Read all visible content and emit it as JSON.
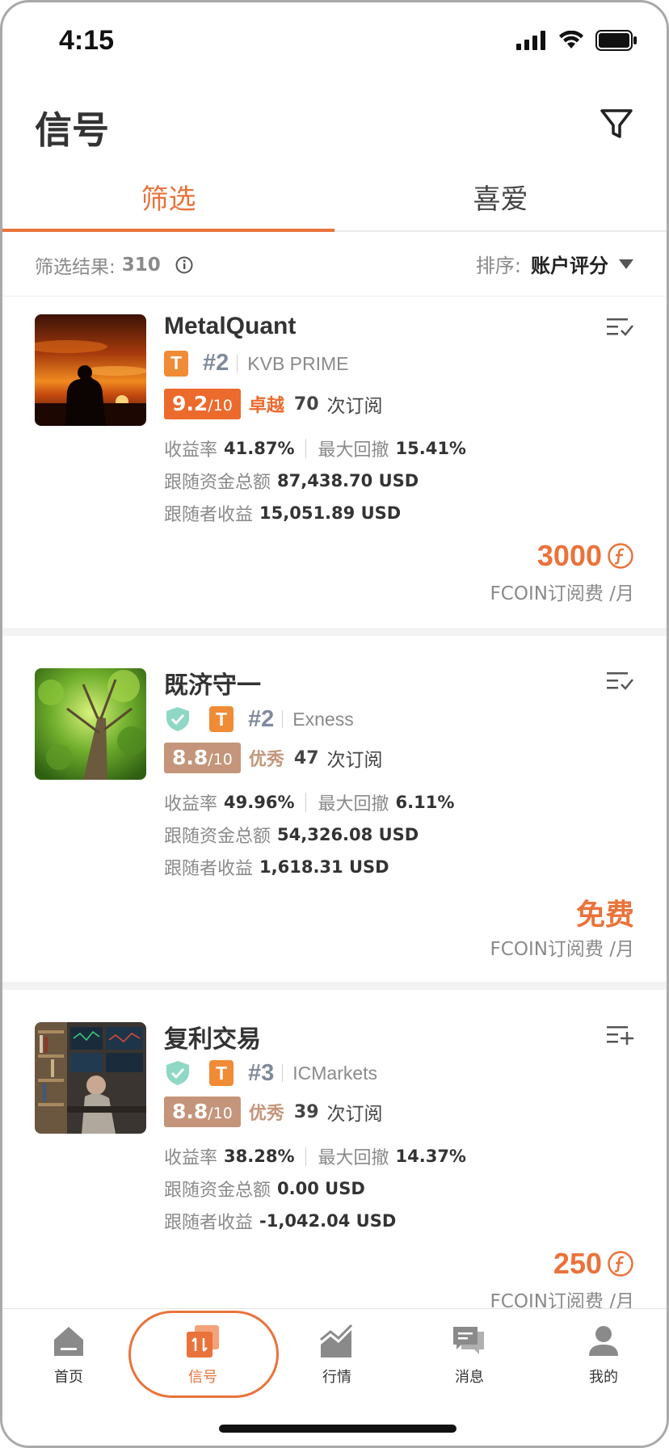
{
  "status_bar": {
    "time": "4:15"
  },
  "header": {
    "title": "信号"
  },
  "tabs": [
    {
      "label": "筛选",
      "active": true
    },
    {
      "label": "喜爱",
      "active": false
    }
  ],
  "result_bar": {
    "label": "筛选结果:",
    "count": "310",
    "sort_label": "排序:",
    "sort_value": "账户评分"
  },
  "colors": {
    "accent": "#e9733b",
    "score_excellent": "#ec6a2c",
    "score_good": "#c4957a",
    "shield": "#8fd8c6"
  },
  "signals": [
    {
      "name": "MetalQuant",
      "verified": false,
      "rank": "#2",
      "broker": "KVB PRIME",
      "score": "9.2",
      "score_den": "/10",
      "level": "卓越",
      "subs": "70",
      "subs_label": "次订阅",
      "return_label": "收益率",
      "return_value": "41.87%",
      "drawdown_label": "最大回撤",
      "drawdown_value": "15.41%",
      "funds_label": "跟随资金总额",
      "funds_value": "87,438.70 USD",
      "profit_label": "跟随者收益",
      "profit_value": "15,051.89 USD",
      "price": "3000",
      "price_label": "FCOIN订阅费 /月",
      "list_icon": "list-check-icon"
    },
    {
      "name": "既济守一",
      "verified": true,
      "rank": "#2",
      "broker": "Exness",
      "score": "8.8",
      "score_den": "/10",
      "level": "优秀",
      "subs": "47",
      "subs_label": "次订阅",
      "return_label": "收益率",
      "return_value": "49.96%",
      "drawdown_label": "最大回撤",
      "drawdown_value": "6.11%",
      "funds_label": "跟随资金总额",
      "funds_value": "54,326.08 USD",
      "profit_label": "跟随者收益",
      "profit_value": "1,618.31 USD",
      "price": "免费",
      "price_label": "FCOIN订阅费 /月",
      "list_icon": "list-check-icon"
    },
    {
      "name": "复利交易",
      "verified": true,
      "rank": "#3",
      "broker": "ICMarkets",
      "score": "8.8",
      "score_den": "/10",
      "level": "优秀",
      "subs": "39",
      "subs_label": "次订阅",
      "return_label": "收益率",
      "return_value": "38.28%",
      "drawdown_label": "最大回撤",
      "drawdown_value": "14.37%",
      "funds_label": "跟随资金总额",
      "funds_value": "0.00 USD",
      "profit_label": "跟随者收益",
      "profit_value": "-1,042.04 USD",
      "price": "250",
      "price_label": "FCOIN订阅费 /月",
      "list_icon": "list-add-icon"
    }
  ],
  "bottom_nav": [
    {
      "label": "首页",
      "icon": "home-icon",
      "active": false
    },
    {
      "label": "信号",
      "icon": "signal-icon",
      "active": true
    },
    {
      "label": "行情",
      "icon": "market-chart-icon",
      "active": false
    },
    {
      "label": "消息",
      "icon": "messages-icon",
      "active": false
    },
    {
      "label": "我的",
      "icon": "profile-icon",
      "active": false
    }
  ]
}
